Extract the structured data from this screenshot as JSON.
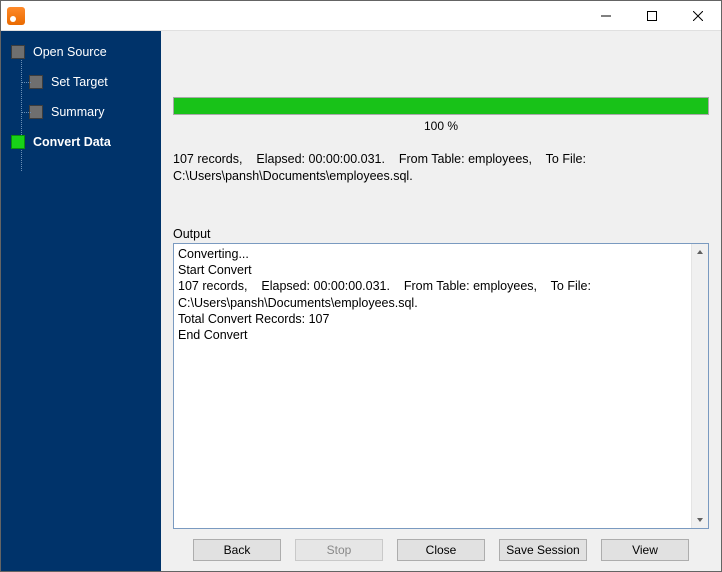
{
  "sidebar": {
    "steps": [
      {
        "label": "Open Source",
        "active": false
      },
      {
        "label": "Set Target",
        "active": false
      },
      {
        "label": "Summary",
        "active": false
      },
      {
        "label": "Convert Data",
        "active": true
      }
    ]
  },
  "progress": {
    "percent_text": "100 %"
  },
  "summary_text": "107 records,    Elapsed: 00:00:00.031.    From Table: employees,    To File: C:\\Users\\pansh\\Documents\\employees.sql.",
  "output": {
    "label": "Output",
    "text": "Converting...\nStart Convert\n107 records,    Elapsed: 00:00:00.031.    From Table: employees,    To File: C:\\Users\\pansh\\Documents\\employees.sql.\nTotal Convert Records: 107\nEnd Convert\n"
  },
  "buttons": {
    "back": "Back",
    "stop": "Stop",
    "close": "Close",
    "save_session": "Save Session",
    "view": "View"
  }
}
